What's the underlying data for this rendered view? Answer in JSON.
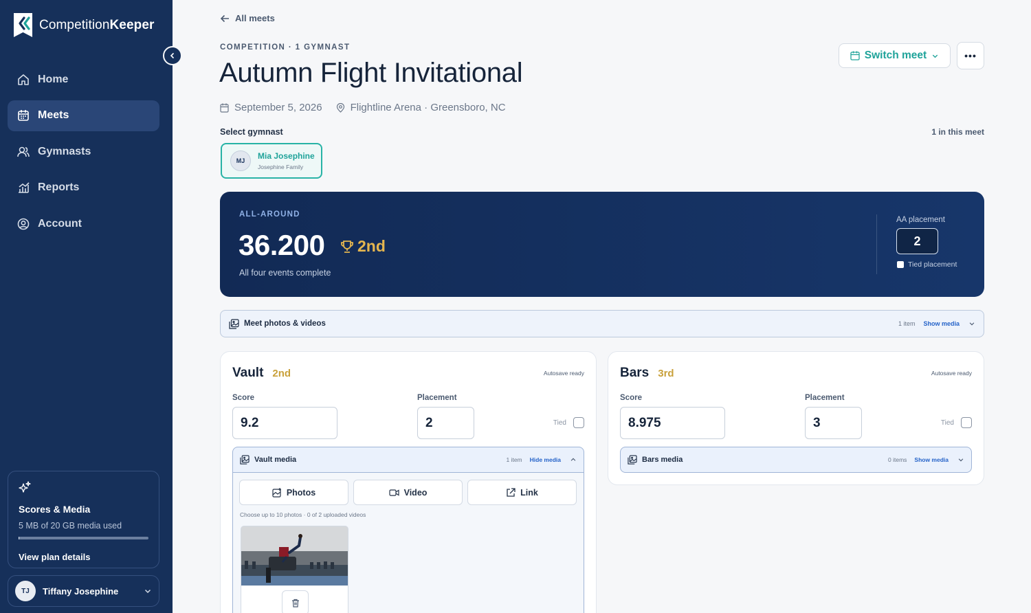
{
  "brand": {
    "name_regular": "Competition",
    "name_bold": "Keeper"
  },
  "nav": [
    {
      "label": "Home",
      "icon": "home-icon"
    },
    {
      "label": "Meets",
      "icon": "calendar-icon",
      "active": true
    },
    {
      "label": "Gymnasts",
      "icon": "users-icon"
    },
    {
      "label": "Reports",
      "icon": "chart-icon"
    },
    {
      "label": "Account",
      "icon": "user-circle-icon"
    }
  ],
  "plan": {
    "title": "Scores & Media",
    "usage": "5 MB of 20 GB media used",
    "usage_fraction": 0.00025,
    "link": "View plan details"
  },
  "user": {
    "initials": "TJ",
    "name": "Tiffany Josephine"
  },
  "header": {
    "back_label": "All meets",
    "eyebrow": "COMPETITION · 1 GYMNAST",
    "title": "Autumn Flight Invitational",
    "date": "September 5, 2026",
    "location": "Flightline Arena · Greensboro, NC",
    "switch_label": "Switch meet",
    "more_label": "•••"
  },
  "gymnast_select": {
    "label": "Select gymnast",
    "count": "1 in this meet",
    "gymnast": {
      "initials": "MJ",
      "name": "Mia Josephine",
      "family": "Josephine Family"
    }
  },
  "all_around": {
    "eyebrow": "ALL-AROUND",
    "score": "36.200",
    "placement_text": "2nd",
    "subtitle": "All four events complete",
    "placement_label": "AA placement",
    "placement_value": "2",
    "tied_label": "Tied placement"
  },
  "meet_media": {
    "title": "Meet photos & videos",
    "count": "1 item",
    "action": "Show media"
  },
  "events": {
    "vault": {
      "name": "Vault",
      "placement_text": "2nd",
      "autosave": "Autosave ready",
      "score_label": "Score",
      "score": "9.2",
      "placement_label": "Placement",
      "placement": "2",
      "tied_label": "Tied",
      "media": {
        "title": "Vault media",
        "count": "1 item",
        "action": "Hide media"
      },
      "upload": {
        "photos": "Photos",
        "video": "Video",
        "link": "Link",
        "note": "Choose up to 10 photos · 0 of 2 uploaded videos"
      }
    },
    "bars": {
      "name": "Bars",
      "placement_text": "3rd",
      "autosave": "Autosave ready",
      "score_label": "Score",
      "score": "8.975",
      "placement_label": "Placement",
      "placement": "3",
      "tied_label": "Tied",
      "media": {
        "title": "Bars media",
        "count": "0 items",
        "action": "Show media"
      }
    }
  },
  "colors": {
    "sidebar": "#16305a",
    "accent_teal": "#1fa39a",
    "gold": "#e5b64f",
    "link_blue": "#2563c9"
  }
}
